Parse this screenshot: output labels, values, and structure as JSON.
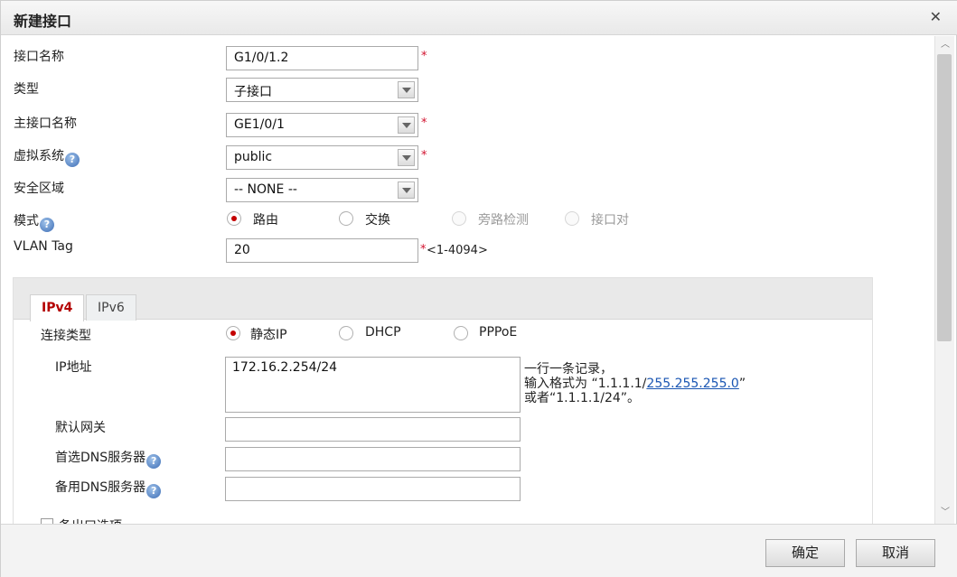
{
  "dialog": {
    "title": "新建接口",
    "close_icon": "close-icon"
  },
  "form": {
    "interface_name": {
      "label": "接口名称",
      "value": "G1/0/1.2",
      "required": "*"
    },
    "type": {
      "label": "类型",
      "value": "子接口"
    },
    "main_interface": {
      "label": "主接口名称",
      "value": "GE1/0/1",
      "required": "*"
    },
    "virtual_system": {
      "label": "虚拟系统",
      "value": "public",
      "required": "*"
    },
    "security_zone": {
      "label": "安全区域",
      "value": "-- NONE --"
    },
    "mode": {
      "label": "模式",
      "options": [
        "路由",
        "交换",
        "旁路检测",
        "接口对"
      ],
      "selected": "路由"
    },
    "vlan_tag": {
      "label": "VLAN Tag",
      "value": "20",
      "required": "*",
      "range_hint": "<1-4094>"
    }
  },
  "tabs": {
    "items": [
      "IPv4",
      "IPv6"
    ],
    "active": "IPv4"
  },
  "ipv4": {
    "connection_type": {
      "label": "连接类型",
      "options": [
        "静态IP",
        "DHCP",
        "PPPoE"
      ],
      "selected": "静态IP"
    },
    "ip_address": {
      "label": "IP地址",
      "value": "172.16.2.254/24",
      "notes": {
        "line1": "一行一条记录，",
        "line2_prefix": "输入格式为 “1.1.1.1/",
        "line2_link": "255.255.255.0",
        "line2_suffix": "”",
        "line3": "或者“1.1.1.1/24”。"
      }
    },
    "default_gateway": {
      "label": "默认网关",
      "value": ""
    },
    "primary_dns": {
      "label": "首选DNS服务器",
      "value": ""
    },
    "secondary_dns": {
      "label": "备用DNS服务器",
      "value": ""
    },
    "partial_option": "备出口选项"
  },
  "buttons": {
    "ok": "确定",
    "cancel": "取消"
  },
  "help_icon_glyph": "?",
  "colors": {
    "required": "#d2122e",
    "active_tab": "#b30000",
    "link": "#1a56b3",
    "radio_checked": "#c40000"
  }
}
